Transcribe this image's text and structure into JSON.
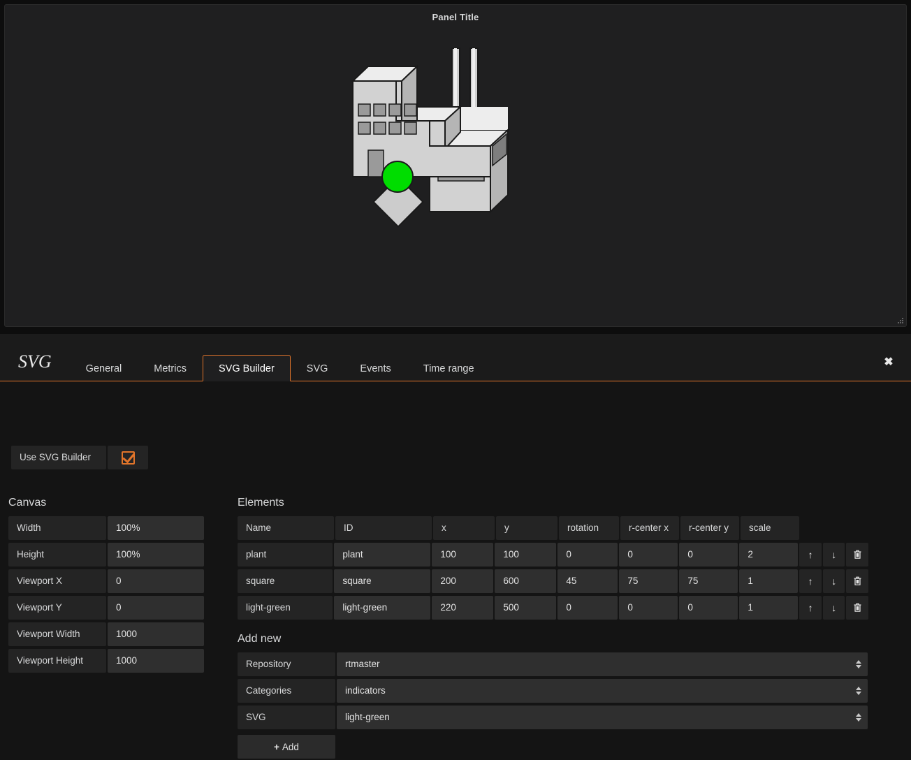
{
  "panel": {
    "title": "Panel Title",
    "graphic": {
      "name": "industrial-plant-with-indicator",
      "body_color": "#d2d2d2",
      "roof_color": "#ededed",
      "side_color": "#b5b5b5",
      "window_color": "#9a9a9a",
      "indicator_color": "#00dd00",
      "outline_color": "#1a1a1a"
    }
  },
  "editor": {
    "brand": "SVG",
    "close_label": "✖",
    "tabs": [
      {
        "label": "General",
        "active": false
      },
      {
        "label": "Metrics",
        "active": false
      },
      {
        "label": "SVG Builder",
        "active": true
      },
      {
        "label": "SVG",
        "active": false
      },
      {
        "label": "Events",
        "active": false
      },
      {
        "label": "Time range",
        "active": false
      }
    ],
    "accent_color": "#e2752a"
  },
  "use_builder": {
    "label": "Use SVG Builder",
    "checked": true
  },
  "canvas": {
    "title": "Canvas",
    "fields": [
      {
        "label": "Width",
        "value": "100%"
      },
      {
        "label": "Height",
        "value": "100%"
      },
      {
        "label": "Viewport X",
        "value": "0"
      },
      {
        "label": "Viewport Y",
        "value": "0"
      },
      {
        "label": "Viewport Width",
        "value": "1000"
      },
      {
        "label": "Viewport Height",
        "value": "1000"
      }
    ]
  },
  "elements": {
    "title": "Elements",
    "columns": [
      "Name",
      "ID",
      "x",
      "y",
      "rotation",
      "r-center x",
      "r-center y",
      "scale"
    ],
    "rows": [
      {
        "name": "plant",
        "id": "plant",
        "x": "100",
        "y": "100",
        "rotation": "0",
        "rcx": "0",
        "rcy": "0",
        "scale": "2"
      },
      {
        "name": "square",
        "id": "square",
        "x": "200",
        "y": "600",
        "rotation": "45",
        "rcx": "75",
        "rcy": "75",
        "scale": "1"
      },
      {
        "name": "light-green",
        "id": "light-green",
        "x": "220",
        "y": "500",
        "rotation": "0",
        "rcx": "0",
        "rcy": "0",
        "scale": "1"
      }
    ],
    "actions": {
      "move_up": "↑",
      "move_down": "↓",
      "delete": "🗑"
    }
  },
  "add_new": {
    "title": "Add new",
    "fields": [
      {
        "label": "Repository",
        "value": "rtmaster"
      },
      {
        "label": "Categories",
        "value": "indicators"
      },
      {
        "label": "SVG",
        "value": "light-green"
      }
    ],
    "add_button": "Add",
    "add_button_icon": "+"
  }
}
